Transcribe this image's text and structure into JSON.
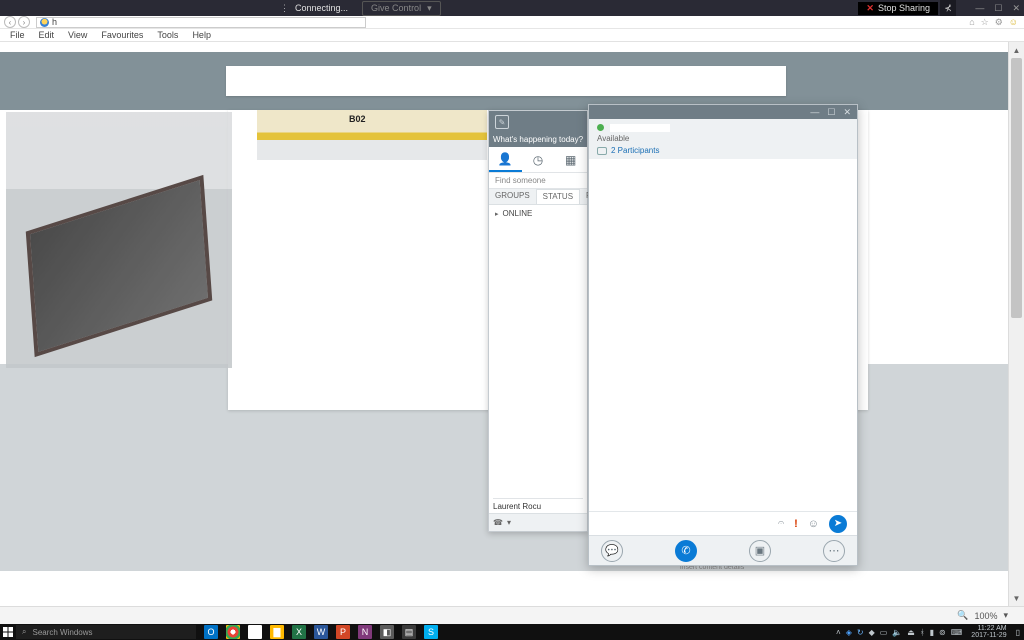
{
  "share_bar": {
    "connecting": "Connecting...",
    "give_control": "Give Control",
    "stop_sharing": "Stop Sharing"
  },
  "browser": {
    "address": "h",
    "menu": {
      "file": "File",
      "edit": "Edit",
      "view": "View",
      "favourites": "Favourites",
      "tools": "Tools",
      "help": "Help"
    },
    "zoom": "100%"
  },
  "web": {
    "strip_tag": "B02",
    "content_scrap": "insert content details"
  },
  "im_main": {
    "whats_happening": "What's happening today?",
    "find_placeholder": "Find someone",
    "tabs": {
      "groups": "GROUPS",
      "status": "STATUS",
      "relat": "RELAT"
    },
    "group_online": "ONLINE",
    "contact_name": "Laurent Rocu"
  },
  "conversation": {
    "available": "Available",
    "participants_count": 2,
    "participants_label": "2 Participants"
  },
  "taskbar": {
    "search_placeholder": "Search Windows",
    "time": "11:22 AM",
    "date": "2017-11-29"
  }
}
